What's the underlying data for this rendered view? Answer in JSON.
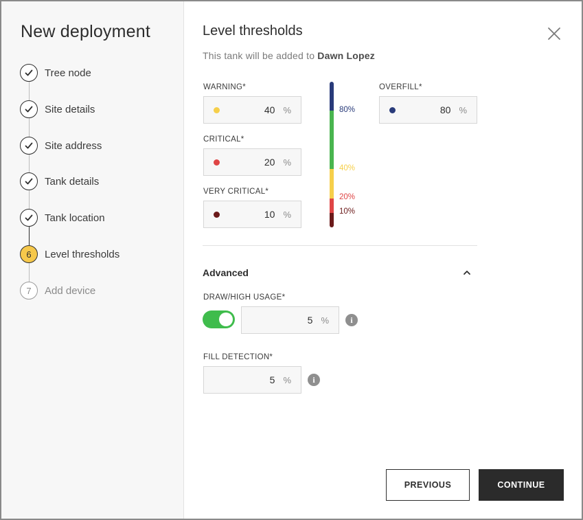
{
  "sidebar": {
    "title": "New deployment",
    "steps": [
      {
        "label": "Tree node",
        "status": "done"
      },
      {
        "label": "Site details",
        "status": "done"
      },
      {
        "label": "Site address",
        "status": "done"
      },
      {
        "label": "Tank details",
        "status": "done"
      },
      {
        "label": "Tank location",
        "status": "done"
      },
      {
        "label": "Level thresholds",
        "status": "current",
        "number": "6"
      },
      {
        "label": "Add device",
        "status": "todo",
        "number": "7"
      }
    ]
  },
  "main": {
    "title": "Level thresholds",
    "subtitle_prefix": "This tank will be added to",
    "subtitle_name": "Dawn Lopez",
    "thresholds": {
      "warning": {
        "label": "WARNING*",
        "value": "40",
        "unit": "%",
        "color": "#f6cf4a"
      },
      "critical": {
        "label": "CRITICAL*",
        "value": "20",
        "unit": "%",
        "color": "#df4545"
      },
      "very_critical": {
        "label": "VERY CRITICAL*",
        "value": "10",
        "unit": "%",
        "color": "#6b1a1a"
      },
      "overfill": {
        "label": "OVERFILL*",
        "value": "80",
        "unit": "%",
        "color": "#293b7a"
      }
    },
    "gauge": {
      "labels": {
        "overfill": "80%",
        "warning": "40%",
        "critical": "20%",
        "very_critical": "10%"
      },
      "levels": {
        "overfill": 80,
        "warning": 40,
        "critical": 20,
        "very_critical": 10
      },
      "colors": {
        "overfill": "#293b7a",
        "normal": "#49b54f",
        "warning": "#f6cf4a",
        "critical": "#df4545",
        "very_critical": "#6b1a1a"
      }
    },
    "advanced": {
      "title": "Advanced",
      "draw_high_usage": {
        "label": "DRAW/HIGH USAGE*",
        "value": "5",
        "unit": "%",
        "enabled": true
      },
      "fill_detection": {
        "label": "FILL DETECTION*",
        "value": "5",
        "unit": "%"
      },
      "info_glyph": "i"
    },
    "buttons": {
      "previous": "PREVIOUS",
      "continue": "CONTINUE"
    },
    "icons": {
      "close": "close-icon",
      "collapse": "chevron-up-icon",
      "info": "info-icon",
      "check": "check-icon"
    }
  }
}
